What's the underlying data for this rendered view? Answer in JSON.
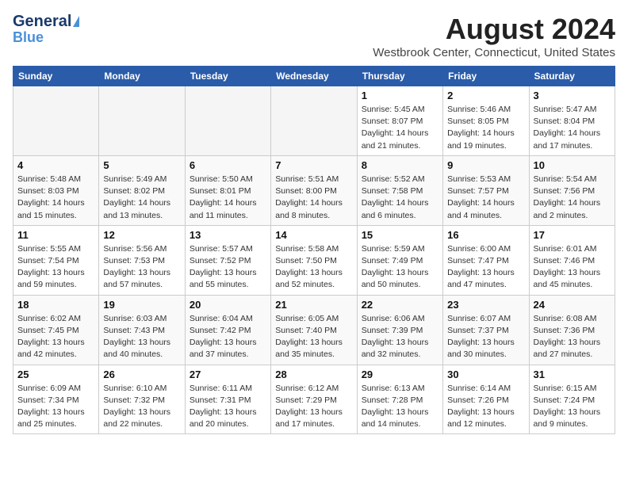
{
  "header": {
    "logo_line1": "General",
    "logo_line2": "Blue",
    "month_title": "August 2024",
    "location": "Westbrook Center, Connecticut, United States"
  },
  "columns": [
    "Sunday",
    "Monday",
    "Tuesday",
    "Wednesday",
    "Thursday",
    "Friday",
    "Saturday"
  ],
  "weeks": [
    [
      {
        "day": "",
        "info": ""
      },
      {
        "day": "",
        "info": ""
      },
      {
        "day": "",
        "info": ""
      },
      {
        "day": "",
        "info": ""
      },
      {
        "day": "1",
        "info": "Sunrise: 5:45 AM\nSunset: 8:07 PM\nDaylight: 14 hours\nand 21 minutes."
      },
      {
        "day": "2",
        "info": "Sunrise: 5:46 AM\nSunset: 8:05 PM\nDaylight: 14 hours\nand 19 minutes."
      },
      {
        "day": "3",
        "info": "Sunrise: 5:47 AM\nSunset: 8:04 PM\nDaylight: 14 hours\nand 17 minutes."
      }
    ],
    [
      {
        "day": "4",
        "info": "Sunrise: 5:48 AM\nSunset: 8:03 PM\nDaylight: 14 hours\nand 15 minutes."
      },
      {
        "day": "5",
        "info": "Sunrise: 5:49 AM\nSunset: 8:02 PM\nDaylight: 14 hours\nand 13 minutes."
      },
      {
        "day": "6",
        "info": "Sunrise: 5:50 AM\nSunset: 8:01 PM\nDaylight: 14 hours\nand 11 minutes."
      },
      {
        "day": "7",
        "info": "Sunrise: 5:51 AM\nSunset: 8:00 PM\nDaylight: 14 hours\nand 8 minutes."
      },
      {
        "day": "8",
        "info": "Sunrise: 5:52 AM\nSunset: 7:58 PM\nDaylight: 14 hours\nand 6 minutes."
      },
      {
        "day": "9",
        "info": "Sunrise: 5:53 AM\nSunset: 7:57 PM\nDaylight: 14 hours\nand 4 minutes."
      },
      {
        "day": "10",
        "info": "Sunrise: 5:54 AM\nSunset: 7:56 PM\nDaylight: 14 hours\nand 2 minutes."
      }
    ],
    [
      {
        "day": "11",
        "info": "Sunrise: 5:55 AM\nSunset: 7:54 PM\nDaylight: 13 hours\nand 59 minutes."
      },
      {
        "day": "12",
        "info": "Sunrise: 5:56 AM\nSunset: 7:53 PM\nDaylight: 13 hours\nand 57 minutes."
      },
      {
        "day": "13",
        "info": "Sunrise: 5:57 AM\nSunset: 7:52 PM\nDaylight: 13 hours\nand 55 minutes."
      },
      {
        "day": "14",
        "info": "Sunrise: 5:58 AM\nSunset: 7:50 PM\nDaylight: 13 hours\nand 52 minutes."
      },
      {
        "day": "15",
        "info": "Sunrise: 5:59 AM\nSunset: 7:49 PM\nDaylight: 13 hours\nand 50 minutes."
      },
      {
        "day": "16",
        "info": "Sunrise: 6:00 AM\nSunset: 7:47 PM\nDaylight: 13 hours\nand 47 minutes."
      },
      {
        "day": "17",
        "info": "Sunrise: 6:01 AM\nSunset: 7:46 PM\nDaylight: 13 hours\nand 45 minutes."
      }
    ],
    [
      {
        "day": "18",
        "info": "Sunrise: 6:02 AM\nSunset: 7:45 PM\nDaylight: 13 hours\nand 42 minutes."
      },
      {
        "day": "19",
        "info": "Sunrise: 6:03 AM\nSunset: 7:43 PM\nDaylight: 13 hours\nand 40 minutes."
      },
      {
        "day": "20",
        "info": "Sunrise: 6:04 AM\nSunset: 7:42 PM\nDaylight: 13 hours\nand 37 minutes."
      },
      {
        "day": "21",
        "info": "Sunrise: 6:05 AM\nSunset: 7:40 PM\nDaylight: 13 hours\nand 35 minutes."
      },
      {
        "day": "22",
        "info": "Sunrise: 6:06 AM\nSunset: 7:39 PM\nDaylight: 13 hours\nand 32 minutes."
      },
      {
        "day": "23",
        "info": "Sunrise: 6:07 AM\nSunset: 7:37 PM\nDaylight: 13 hours\nand 30 minutes."
      },
      {
        "day": "24",
        "info": "Sunrise: 6:08 AM\nSunset: 7:36 PM\nDaylight: 13 hours\nand 27 minutes."
      }
    ],
    [
      {
        "day": "25",
        "info": "Sunrise: 6:09 AM\nSunset: 7:34 PM\nDaylight: 13 hours\nand 25 minutes."
      },
      {
        "day": "26",
        "info": "Sunrise: 6:10 AM\nSunset: 7:32 PM\nDaylight: 13 hours\nand 22 minutes."
      },
      {
        "day": "27",
        "info": "Sunrise: 6:11 AM\nSunset: 7:31 PM\nDaylight: 13 hours\nand 20 minutes."
      },
      {
        "day": "28",
        "info": "Sunrise: 6:12 AM\nSunset: 7:29 PM\nDaylight: 13 hours\nand 17 minutes."
      },
      {
        "day": "29",
        "info": "Sunrise: 6:13 AM\nSunset: 7:28 PM\nDaylight: 13 hours\nand 14 minutes."
      },
      {
        "day": "30",
        "info": "Sunrise: 6:14 AM\nSunset: 7:26 PM\nDaylight: 13 hours\nand 12 minutes."
      },
      {
        "day": "31",
        "info": "Sunrise: 6:15 AM\nSunset: 7:24 PM\nDaylight: 13 hours\nand 9 minutes."
      }
    ]
  ]
}
